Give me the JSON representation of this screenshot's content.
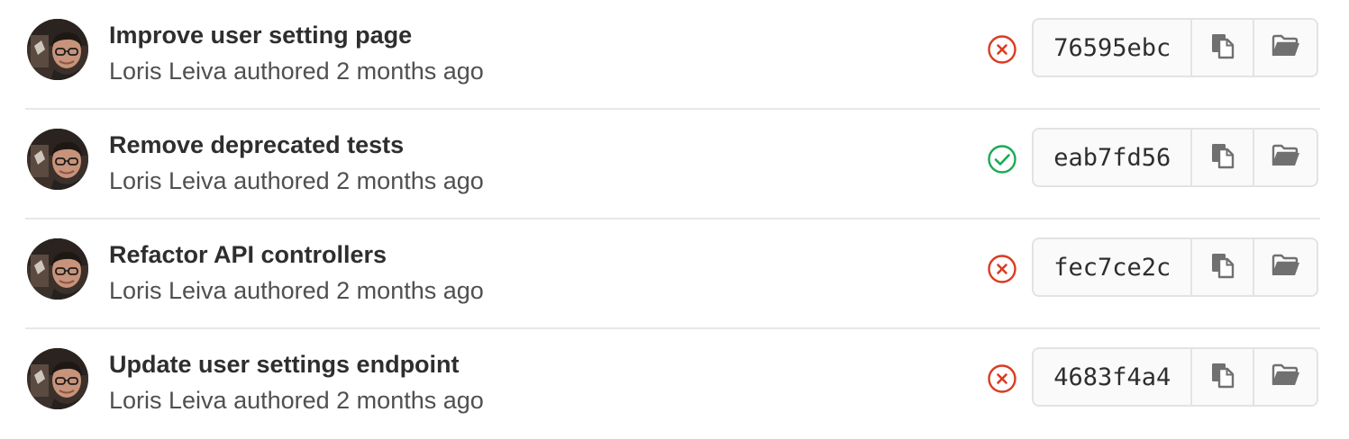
{
  "commits": [
    {
      "title": "Improve user setting page",
      "author": "Loris Leiva",
      "meta": "Loris Leiva authored 2 months ago",
      "status": "failed",
      "sha": "76595ebc"
    },
    {
      "title": "Remove deprecated tests",
      "author": "Loris Leiva",
      "meta": "Loris Leiva authored 2 months ago",
      "status": "success",
      "sha": "eab7fd56"
    },
    {
      "title": "Refactor API controllers",
      "author": "Loris Leiva",
      "meta": "Loris Leiva authored 2 months ago",
      "status": "failed",
      "sha": "fec7ce2c"
    },
    {
      "title": "Update user settings endpoint",
      "author": "Loris Leiva",
      "meta": "Loris Leiva authored 2 months ago",
      "status": "failed",
      "sha": "4683f4a4"
    }
  ],
  "colors": {
    "failed": "#db3b21",
    "success": "#1aaa55",
    "icon": "#707070",
    "border": "#e3e3e3"
  },
  "icons": {
    "failed": "status-failed-icon",
    "success": "status-success-icon",
    "copy": "clipboard-icon",
    "browse": "folder-open-icon"
  }
}
